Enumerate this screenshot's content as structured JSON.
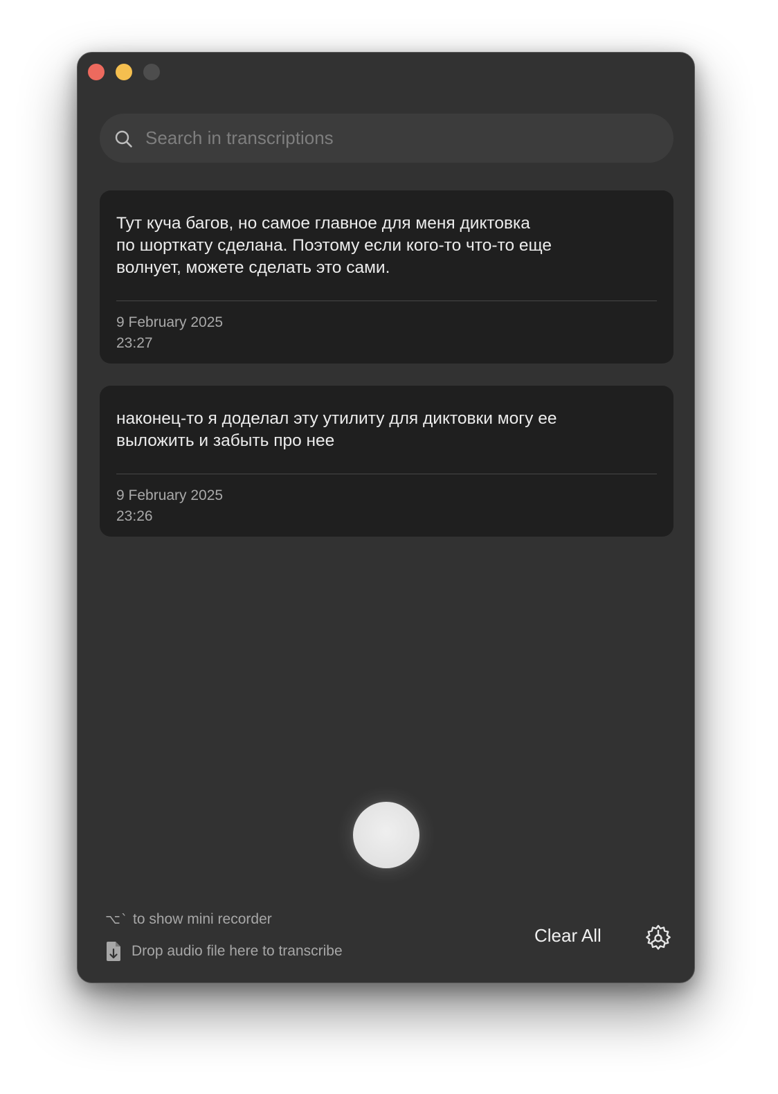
{
  "window": {
    "traffic_lights": [
      {
        "name": "close",
        "color": "#ed6a5e"
      },
      {
        "name": "minimize",
        "color": "#f5bf4f"
      },
      {
        "name": "zoom",
        "color": "#4d4d4d"
      }
    ]
  },
  "search": {
    "placeholder": "Search in transcriptions",
    "value": "",
    "icon": "search-icon"
  },
  "transcriptions": [
    {
      "text": "Тут куча багов, но самое главное для меня диктовка\nпо шорткату сделана. Поэтому если кого-то что-то еще\nволнует, можете сделать это сами.",
      "date": "9 February 2025",
      "time": "23:27"
    },
    {
      "text": "наконец-то я доделал эту утилиту для диктовки могу ее\nвыложить и забыть про нее",
      "date": "9 February 2025",
      "time": "23:26"
    }
  ],
  "record_button": {
    "icon": "record-button",
    "color": "#e6e6e6"
  },
  "footer": {
    "shortcut_glyph": "⌥`",
    "shortcut_hint": "to show mini recorder",
    "drop_hint": "Drop audio file here to transcribe",
    "clear_all_label": "Clear All",
    "settings_icon": "gear-icon"
  },
  "colors": {
    "window_bg": "#323232",
    "card_bg": "#1f1f1f",
    "search_bg": "#3c3c3c",
    "text_primary": "#ececec",
    "text_secondary": "#a9a9a9"
  }
}
